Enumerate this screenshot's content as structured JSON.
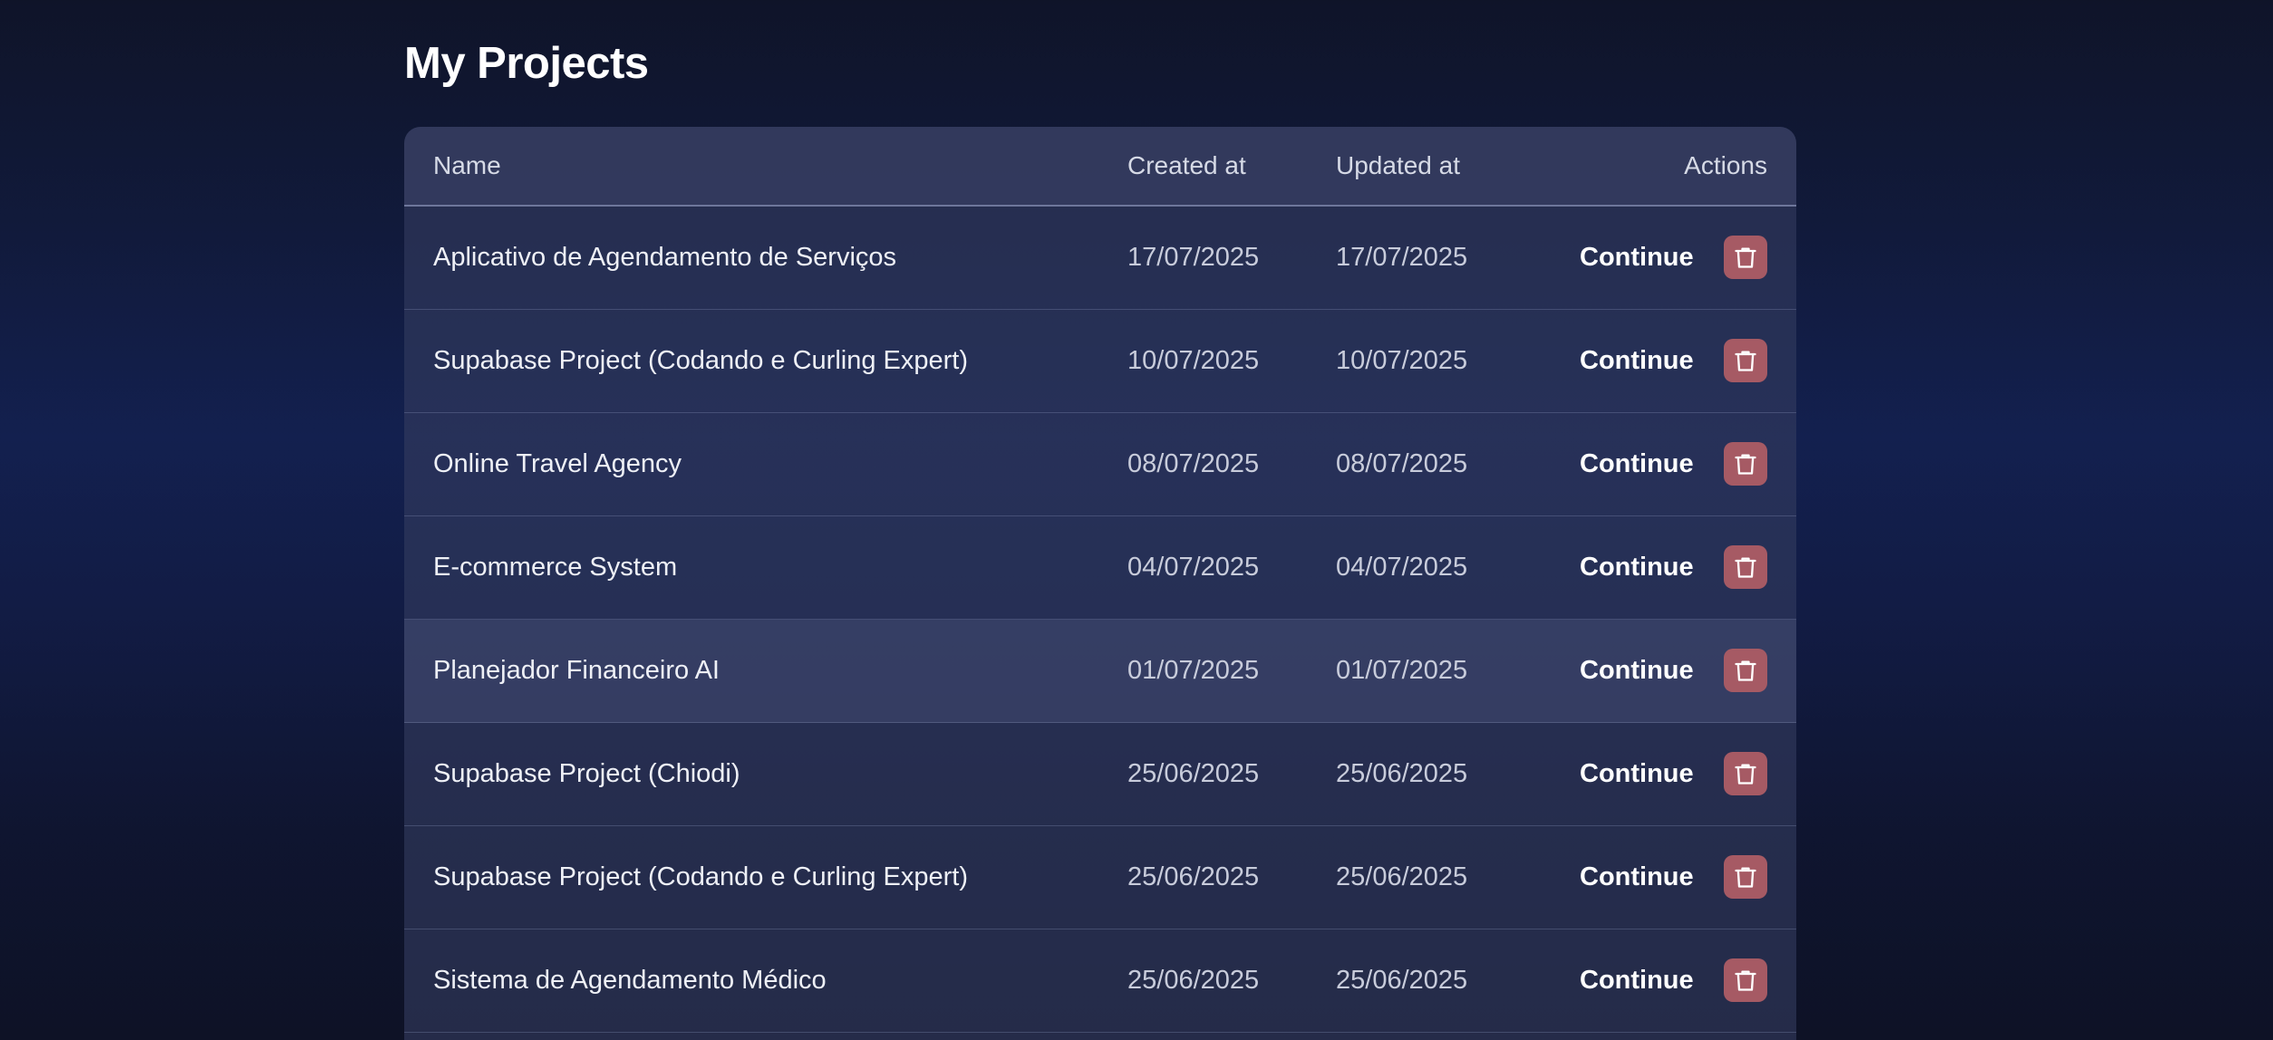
{
  "page": {
    "title": "My Projects"
  },
  "table": {
    "columns": {
      "name": "Name",
      "created": "Created at",
      "updated": "Updated at",
      "actions": "Actions"
    },
    "continue_label": "Continue",
    "delete_icon": "trash-icon",
    "rows": [
      {
        "name": "Aplicativo de Agendamento de Serviços",
        "created": "17/07/2025",
        "updated": "17/07/2025"
      },
      {
        "name": "Supabase Project (Codando e Curling Expert)",
        "created": "10/07/2025",
        "updated": "10/07/2025"
      },
      {
        "name": "Online Travel Agency",
        "created": "08/07/2025",
        "updated": "08/07/2025"
      },
      {
        "name": "E-commerce System",
        "created": "04/07/2025",
        "updated": "04/07/2025"
      },
      {
        "name": "Planejador Financeiro AI",
        "created": "01/07/2025",
        "updated": "01/07/2025"
      },
      {
        "name": "Supabase Project (Chiodi)",
        "created": "25/06/2025",
        "updated": "25/06/2025"
      },
      {
        "name": "Supabase Project (Codando e Curling Expert)",
        "created": "25/06/2025",
        "updated": "25/06/2025"
      },
      {
        "name": "Sistema de Agendamento Médico",
        "created": "25/06/2025",
        "updated": "25/06/2025"
      }
    ]
  },
  "colors": {
    "delete_button": "#a65a64",
    "page_background": "#121c45"
  }
}
